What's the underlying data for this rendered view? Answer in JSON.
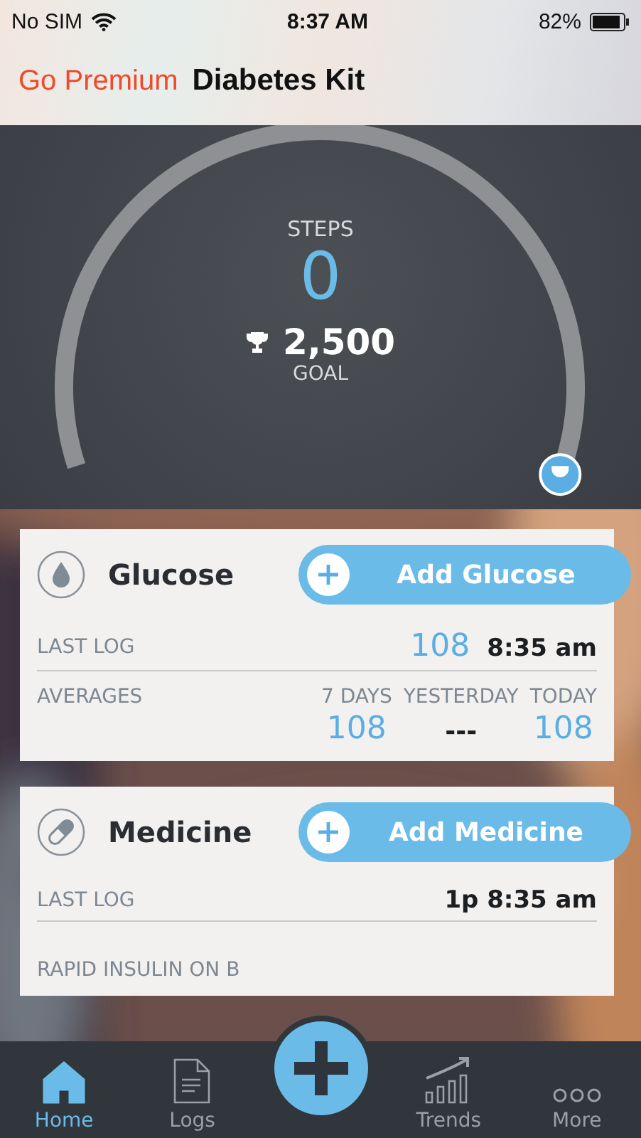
{
  "status_bar": {
    "carrier": "No SIM",
    "time": "8:37 AM",
    "battery": "82%"
  },
  "header": {
    "premium_link": "Go Premium",
    "title": "Diabetes Kit"
  },
  "steps": {
    "label": "STEPS",
    "value": "0",
    "goal": "2,500",
    "goal_label": "GOAL"
  },
  "cards": [
    {
      "kind": "glucose",
      "title": "Glucose",
      "button": "Add Glucose",
      "last_log_label": "LAST LOG",
      "last_log_value": "108",
      "last_log_time": "8:35 am",
      "averages_label": "AVERAGES",
      "averages": [
        {
          "label": "7 DAYS",
          "value": "108"
        },
        {
          "label": "YESTERDAY",
          "value": "---"
        },
        {
          "label": "TODAY",
          "value": "108"
        }
      ]
    },
    {
      "kind": "medicine",
      "title": "Medicine",
      "button": "Add Medicine",
      "last_log_label": "LAST LOG",
      "last_log_time": "1p 8:35 am",
      "extra_label": "RAPID INSULIN ON B"
    }
  ],
  "tab_bar": [
    {
      "kind": "home",
      "label": "Home",
      "selected": true
    },
    {
      "kind": "logs",
      "label": "Logs",
      "selected": false
    },
    {
      "kind": "add"
    },
    {
      "kind": "trends",
      "label": "Trends",
      "selected": false
    },
    {
      "kind": "more",
      "label": "More",
      "selected": false
    }
  ]
}
